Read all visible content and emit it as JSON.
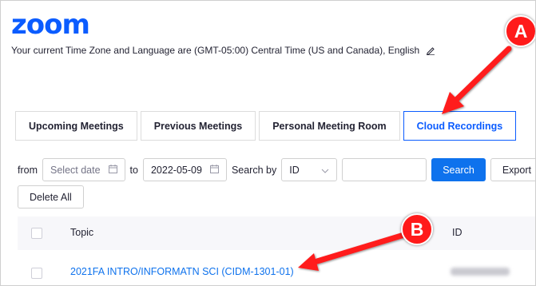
{
  "logo": "zoom",
  "timezone_line": "Your current Time Zone and Language are (GMT-05:00) Central Time (US and Canada), English",
  "tabs": [
    {
      "label": "Upcoming Meetings"
    },
    {
      "label": "Previous Meetings"
    },
    {
      "label": "Personal Meeting Room"
    },
    {
      "label": "Cloud Recordings"
    }
  ],
  "filter": {
    "from_label": "from",
    "from_placeholder": "Select date",
    "to_label": "to",
    "to_value": "2022-05-09",
    "search_by_label": "Search by",
    "search_by_value": "ID",
    "search_button": "Search",
    "export_button": "Export"
  },
  "delete_all_button": "Delete All",
  "table": {
    "columns": [
      "Topic",
      "ID"
    ],
    "rows": [
      {
        "topic": "2021FA INTRO/INFORMATN SCI (CIDM-1301-01)"
      }
    ]
  },
  "annotations": {
    "badge_a": "A",
    "badge_b": "B",
    "accent_color": "#ff1a1a"
  }
}
